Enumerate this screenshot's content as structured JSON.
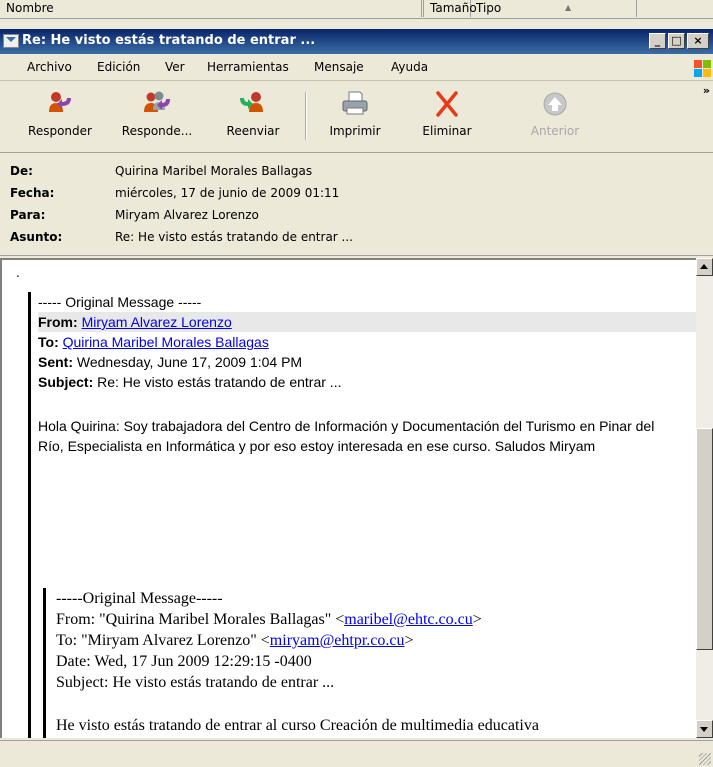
{
  "background_window": {
    "columns": [
      "Nombre",
      "Tamaño",
      "Tipo"
    ]
  },
  "window": {
    "title": "Re: He visto estás tratando de entrar ...",
    "min_label": "_",
    "max_label": "□",
    "close_label": "×"
  },
  "menu": {
    "items": [
      "Archivo",
      "Edición",
      "Ver",
      "Herramientas",
      "Mensaje",
      "Ayuda"
    ]
  },
  "toolbar": {
    "reply": "Responder",
    "reply_all": "Responde...",
    "forward": "Reenviar",
    "print": "Imprimir",
    "delete": "Eliminar",
    "previous": "Anterior",
    "more": "»"
  },
  "header": {
    "from_label": "De:",
    "from_value": "Quirina Maribel Morales Ballagas",
    "date_label": "Fecha:",
    "date_value": "miércoles, 17 de junio de 2009 01:11",
    "to_label": "Para:",
    "to_value": "Miryam  Alvarez Lorenzo",
    "subject_label": "Asunto:",
    "subject_value": "Re: He visto estás tratando de entrar ..."
  },
  "message": {
    "leading_dot": ".",
    "quote1": {
      "separator": "----- Original Message -----",
      "from_label": "From:",
      "from_link": "Miryam Alvarez Lorenzo",
      "to_label": "To:",
      "to_link": "Quirina Maribel Morales Ballagas",
      "sent_label": "Sent:",
      "sent_value": "Wednesday, June 17, 2009 1:04 PM",
      "subject_label": "Subject:",
      "subject_value": "Re: He visto estás tratando de entrar ...",
      "body": "Hola Quirina: Soy trabajadora del Centro de Información y Documentación del Turismo en Pinar del Río, Especialista en Informática  y por eso estoy interesada en ese curso. Saludos Miryam"
    },
    "quote2": {
      "separator": "-----Original Message-----",
      "from_prefix": "From: \"Quirina Maribel Morales Ballagas\" <",
      "from_email": "maribel@ehtc.co.cu",
      "from_suffix": ">",
      "to_prefix": "To: \"Miryam Alvarez Lorenzo\" <",
      "to_email": "miryam@ehtpr.co.cu",
      "to_suffix": ">",
      "date_line": "Date: Wed, 17 Jun 2009 12:29:15 -0400",
      "subject_line": "Subject: He visto estás tratando de entrar ...",
      "body_start": "He visto estás tratando de entrar al curso Creación de multimedia educativa"
    }
  },
  "colors": {
    "titlebar": "#0a246a",
    "link": "#0000ee",
    "delete_x": "#e83a1a"
  }
}
